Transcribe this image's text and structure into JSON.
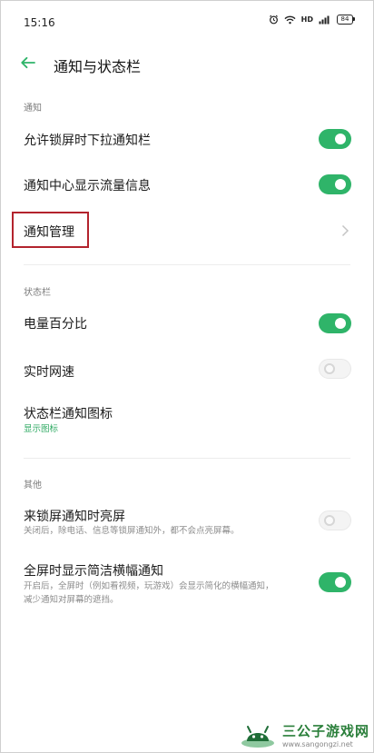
{
  "status_bar": {
    "time": "15:16",
    "icons": [
      "alarm-icon",
      "wifi-icon",
      "hd-icon",
      "signal-icon",
      "battery-icon"
    ],
    "hd_label": "HD",
    "battery_level": "84"
  },
  "header": {
    "back_icon": "back-arrow-icon",
    "title": "通知与状态栏"
  },
  "sections": {
    "notification": {
      "label": "通知",
      "rows": {
        "lockscreen_pull": {
          "title": "允许锁屏时下拉通知栏",
          "toggle_on": true
        },
        "traffic_info": {
          "title": "通知中心显示流量信息",
          "toggle_on": true
        },
        "management": {
          "title": "通知管理"
        }
      }
    },
    "status_bar": {
      "label": "状态栏",
      "rows": {
        "battery_percent": {
          "title": "电量百分比",
          "toggle_on": true
        },
        "net_speed": {
          "title": "实时网速",
          "toggle_on": false
        },
        "icons": {
          "title": "状态栏通知图标",
          "value": "显示图标"
        }
      }
    },
    "other": {
      "label": "其他",
      "rows": {
        "wake_on_notify": {
          "title": "来锁屏通知时亮屏",
          "subtitle": "关闭后，除电话、信息等锁屏通知外，都不会点亮屏幕。",
          "toggle_on": false
        },
        "fullscreen_banner": {
          "title": "全屏时显示简洁横幅通知",
          "subtitle_line1": "开启后，全屏时（例如看视频，玩游戏）会显示简化的横幅通知，",
          "subtitle_line2": "减少通知对屏幕的遮挡。",
          "toggle_on": true
        }
      }
    }
  },
  "colors": {
    "accent": "#2fb469",
    "highlight_border": "#b3232d"
  },
  "watermark": {
    "title": "三公子游戏网",
    "url": "www.sangongzi.net"
  }
}
